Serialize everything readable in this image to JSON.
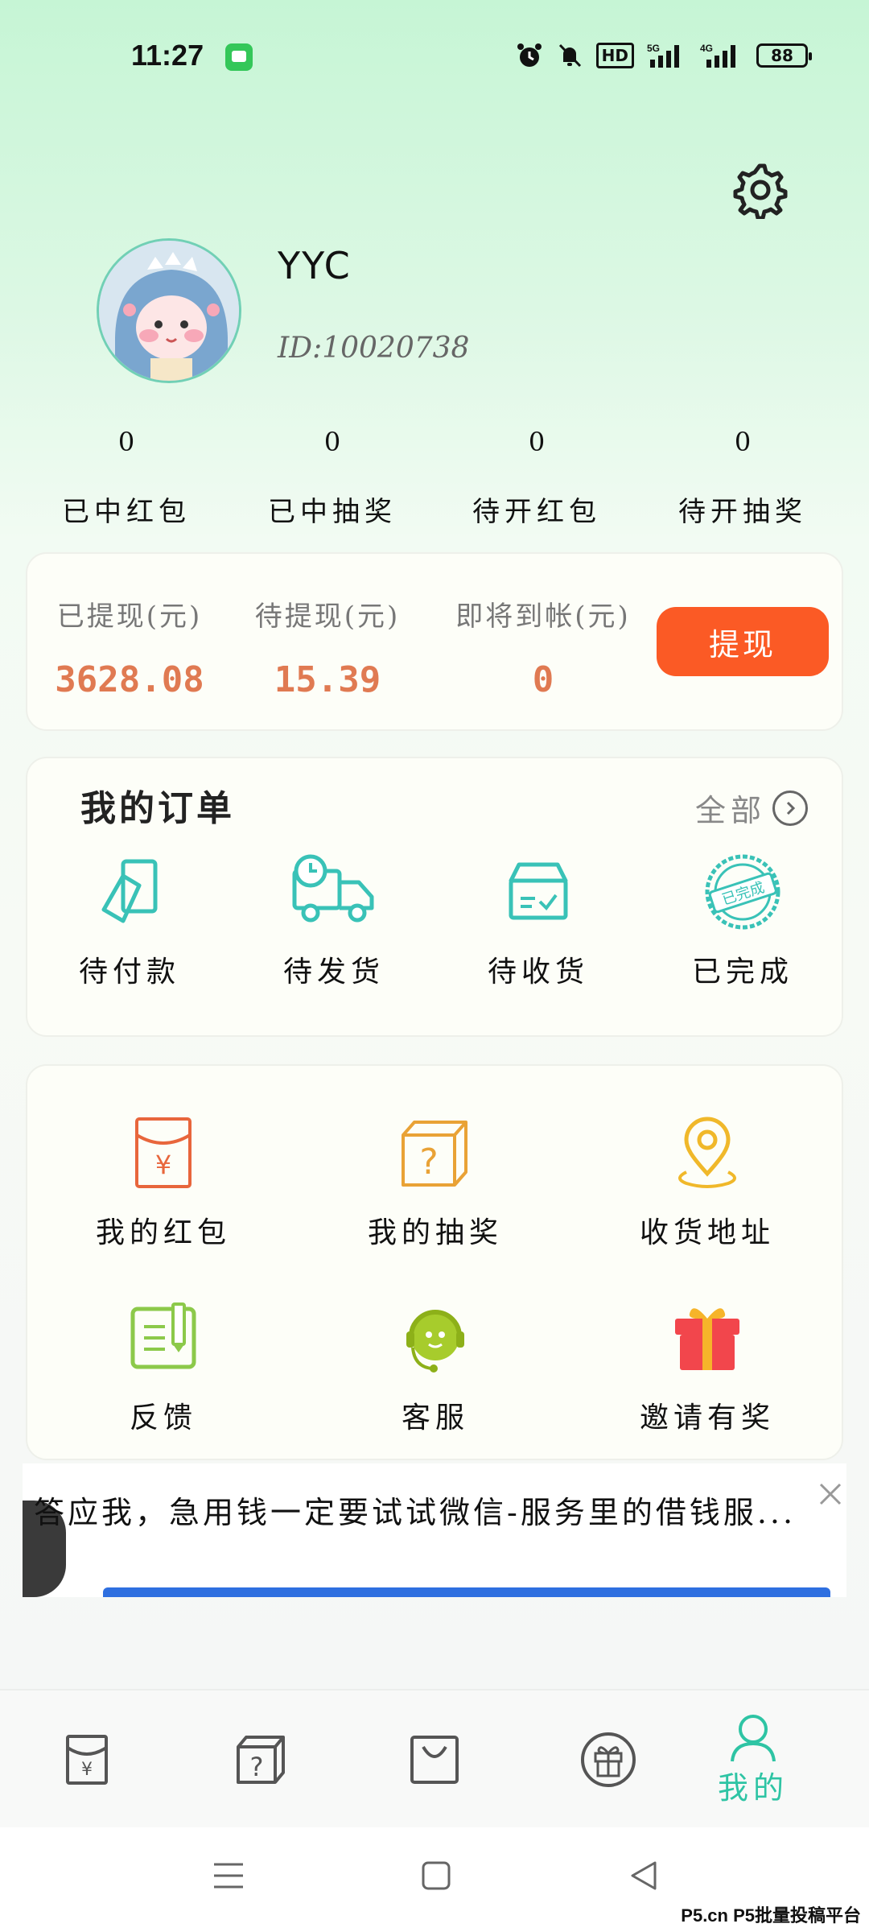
{
  "status_bar": {
    "time": "11:27",
    "network": "HD",
    "battery": "88",
    "signal_1": "5G",
    "signal_2": "4G"
  },
  "profile": {
    "username": "YYC",
    "user_id": "ID:10020738"
  },
  "stats": [
    {
      "value": "0",
      "label": "已中红包"
    },
    {
      "value": "0",
      "label": "已中抽奖"
    },
    {
      "value": "0",
      "label": "待开红包"
    },
    {
      "value": "0",
      "label": "待开抽奖"
    }
  ],
  "withdraw": {
    "withdrawn_label": "已提现(元)",
    "withdrawn_value": "3628.08",
    "pending_label": "待提现(元)",
    "pending_value": "15.39",
    "arriving_label": "即将到帐(元)",
    "arriving_value": "0",
    "button_label": "提现"
  },
  "orders": {
    "title": "我的订单",
    "all_label": "全部",
    "items": [
      {
        "label": "待付款",
        "icon": "payment-card-icon"
      },
      {
        "label": "待发货",
        "icon": "delivery-truck-icon"
      },
      {
        "label": "待收货",
        "icon": "receive-box-icon"
      },
      {
        "label": "已完成",
        "icon": "completed-stamp-icon",
        "stamp_text": "已完成"
      }
    ]
  },
  "services": [
    {
      "label": "我的红包",
      "icon": "red-envelope-icon"
    },
    {
      "label": "我的抽奖",
      "icon": "lottery-box-icon"
    },
    {
      "label": "收货地址",
      "icon": "location-pin-icon"
    },
    {
      "label": "反馈",
      "icon": "feedback-edit-icon"
    },
    {
      "label": "客服",
      "icon": "headset-service-icon"
    },
    {
      "label": "邀请有奖",
      "icon": "gift-box-icon"
    }
  ],
  "ad": {
    "text": "答应我，急用钱一定要试试微信-服务里的借钱服..."
  },
  "bottom_nav": {
    "items": [
      {
        "icon": "red-envelope-tab-icon"
      },
      {
        "icon": "lottery-tab-icon"
      },
      {
        "icon": "shopping-bag-tab-icon"
      },
      {
        "icon": "gift-tab-icon"
      },
      {
        "icon": "profile-tab-icon",
        "label": "我的",
        "active": true
      }
    ]
  },
  "watermark": "P5.cn P5批量投稿平台",
  "colors": {
    "accent": "#2ec4a4",
    "withdraw_button": "#fb5a25",
    "amount": "#e07a52"
  }
}
